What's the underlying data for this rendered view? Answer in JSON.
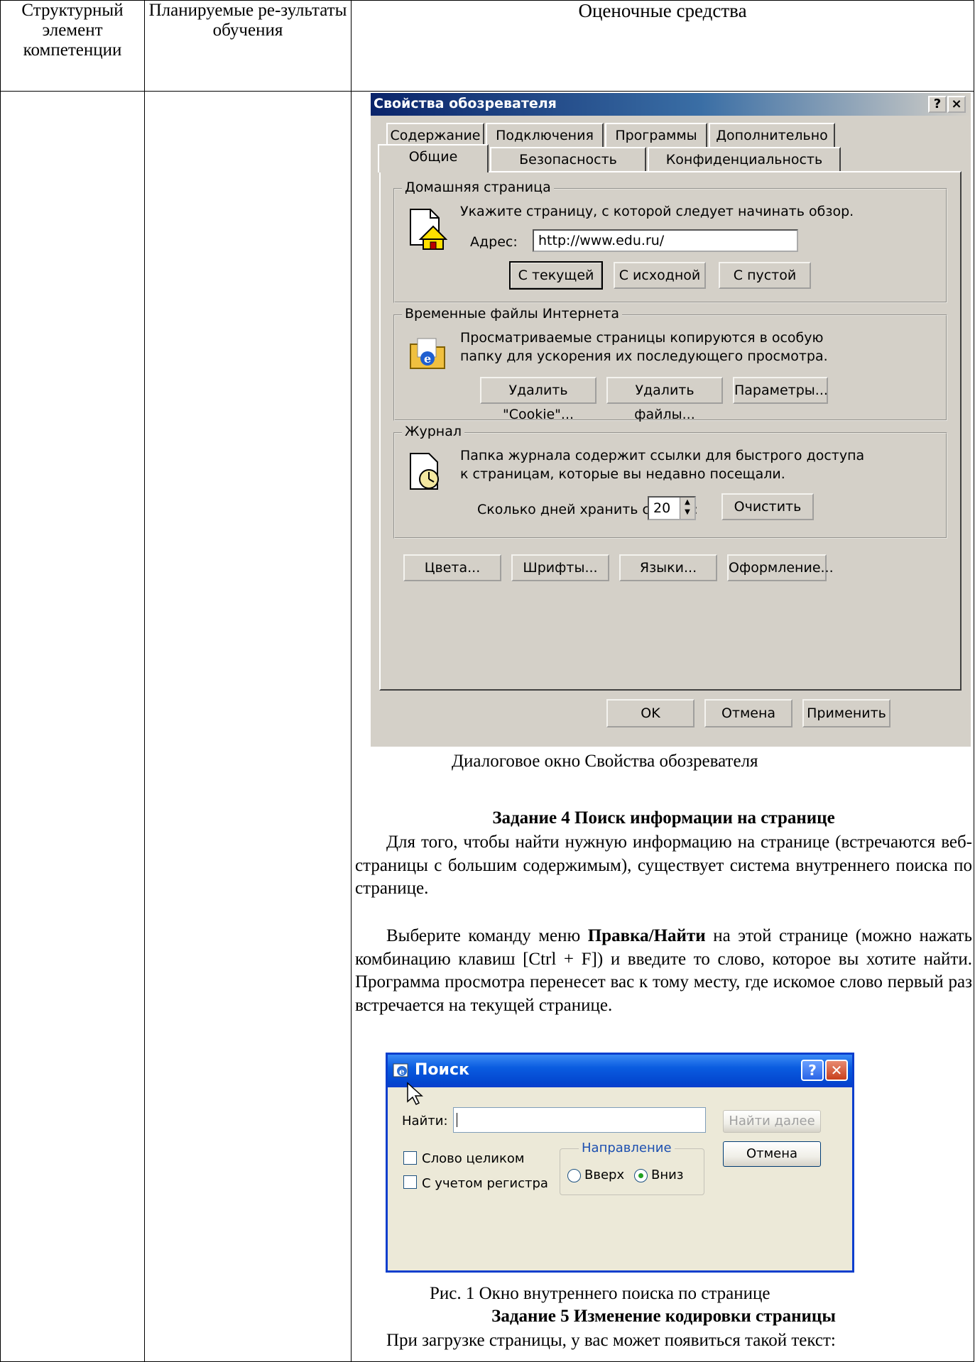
{
  "table": {
    "headers": [
      "Структурный элемент компетенции",
      "Планируемые ре-зультаты обучения",
      "Оценочные средства"
    ]
  },
  "ie_dialog": {
    "title": "Свойства обозревателя",
    "help_button": "?",
    "close_button": "×",
    "tabs_back": [
      "Содержание",
      "Подключения",
      "Программы",
      "Дополнительно"
    ],
    "tabs_front": [
      "Общие",
      "Безопасность",
      "Конфиденциальность"
    ],
    "home": {
      "label": "Домашняя страница",
      "text": "Укажите страницу, с которой следует начинать обзор.",
      "address_label": "Адрес:",
      "address_value": "http://www.edu.ru/",
      "buttons": [
        "С текущей",
        "С исходной",
        "С пустой"
      ]
    },
    "temp": {
      "label": "Временные файлы Интернета",
      "text1": "Просматриваемые страницы копируются в особую",
      "text2": "папку для ускорения их последующего просмотра.",
      "buttons": [
        "Удалить \"Cookie\"...",
        "Удалить файлы...",
        "Параметры..."
      ]
    },
    "history": {
      "label": "Журнал",
      "text1": "Папка журнала содержит ссылки для быстрого доступа",
      "text2": "к страницам, которые вы недавно посещали.",
      "days_label": "Сколько дней хранить ссылки:",
      "days_value": "20",
      "clear_button": "Очистить"
    },
    "bottom_buttons": [
      "Цвета...",
      "Шрифты...",
      "Языки...",
      "Оформление..."
    ],
    "dialog_buttons": [
      "OK",
      "Отмена",
      "Применить"
    ]
  },
  "caption1": "Диалоговое окно Свойства обозревателя",
  "task4": {
    "heading": "Задание 4 Поиск информации на странице",
    "para1": "Для того, чтобы найти нужную информацию на странице (встречаются веб-страницы с большим содержимым), существует система внутреннего поиска по странице.",
    "para2_a": "Выберите команду меню ",
    "para2_bold": "Правка/Найти",
    "para2_b": " на этой странице (можно нажать комбинацию клавиш [Ctrl + F]) и введите то слово, которое вы хотите найти. Программа просмотра перенесет вас к тому месту, где искомое слово первый раз встречается на текущей странице."
  },
  "find_dialog": {
    "title": "Поиск",
    "find_label": "Найти:",
    "find_value": "",
    "find_next_button": "Найти далее",
    "cancel_button": "Отмена",
    "whole_word": "Слово целиком",
    "match_case": "С учетом регистра",
    "direction_label": "Направление",
    "up": "Вверх",
    "down": "Вниз",
    "direction_selected": "Вниз"
  },
  "caption2": "Рис. 1 Окно внутреннего поиска по странице",
  "task5": {
    "heading": "Задание 5 Изменение кодировки страницы",
    "para": "При загрузке страницы, у вас может появиться такой текст:"
  }
}
